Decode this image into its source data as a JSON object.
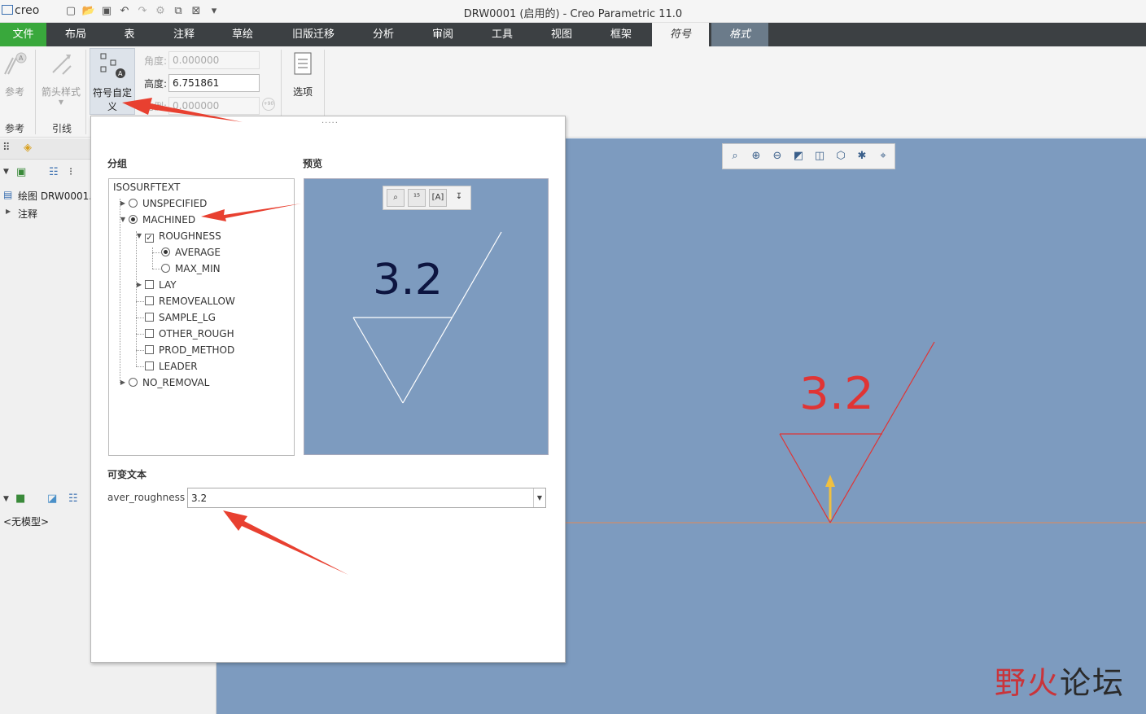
{
  "app": {
    "logo": "creo",
    "window_title": "DRW0001 (启用的) - Creo Parametric 11.0"
  },
  "quick_access": [
    "new-icon",
    "open-icon",
    "save-icon",
    "undo-icon",
    "redo-icon",
    "regenerate-icon",
    "windows-icon",
    "close-icon",
    "customize-icon"
  ],
  "tabs": [
    "文件",
    "布局",
    "表",
    "注释",
    "草绘",
    "旧版迁移",
    "分析",
    "审阅",
    "工具",
    "视图",
    "框架",
    "符号",
    "格式"
  ],
  "ribbon": {
    "reference_label": "参考",
    "arrow_style_label": "箭头样式",
    "custom_symbol_label_1": "符号自定",
    "custom_symbol_label_2": "义",
    "angle_label": "角度:",
    "angle_value": "0.000000",
    "height_label": "高度:",
    "height_value": "6.751861",
    "scale_label": "比例:",
    "scale_value": "0.000000",
    "options_label": "选项",
    "group_reference": "参考",
    "group_leader": "引线"
  },
  "left_panel": {
    "tree_root": "绘图 DRW0001.",
    "tree_notes": "注释",
    "no_model": "<无模型>"
  },
  "dialog": {
    "group_label": "分组",
    "preview_label": "预览",
    "tree": {
      "root": "ISOSURFTEXT",
      "unspecified": "UNSPECIFIED",
      "machined": "MACHINED",
      "roughness": "ROUGHNESS",
      "average": "AVERAGE",
      "max_min": "MAX_MIN",
      "lay": "LAY",
      "removeallow": "REMOVEALLOW",
      "sample_lg": "SAMPLE_LG",
      "other_rough": "OTHER_ROUGH",
      "prod_method": "PROD_METHOD",
      "leader": "LEADER",
      "no_removal": "NO_REMOVAL"
    },
    "selected_group": "MACHINED",
    "roughness_checked": true,
    "selected_roughness_type": "AVERAGE",
    "preview_value": "3.2",
    "variable_text_label": "可变文本",
    "variable_name": "aver_roughness",
    "variable_value": "3.2"
  },
  "graphics": {
    "symbol_value": "3.2"
  },
  "colors": {
    "graphics_bg": "#7d9bbf",
    "file_tab": "#39a83c",
    "symbol_red": "#e03434",
    "annotation_arrow": "#e84030"
  },
  "watermark": {
    "part1": "野火",
    "part2": "论坛"
  }
}
